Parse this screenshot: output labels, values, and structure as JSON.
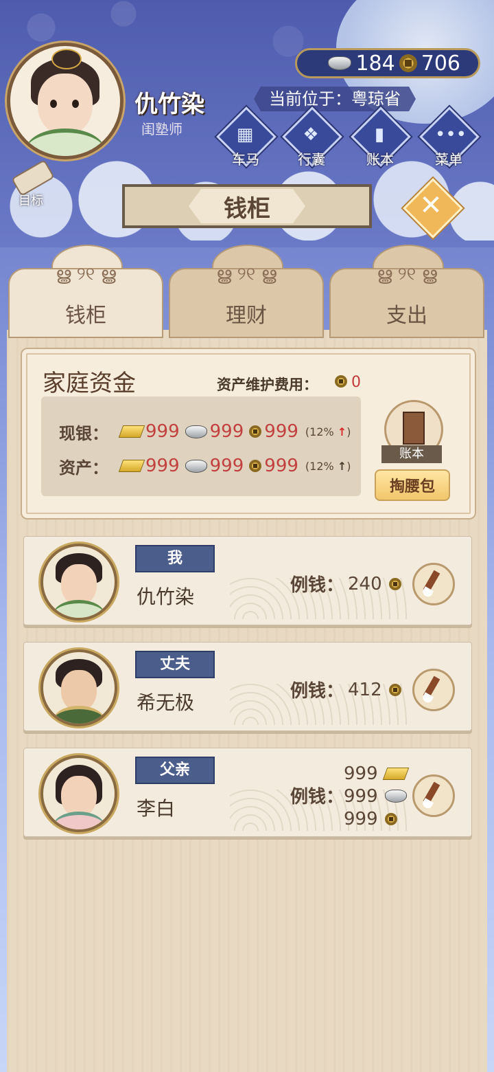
{
  "player": {
    "name": "仇竹染",
    "title": "闺塾师"
  },
  "currency": {
    "silver": "184",
    "coins": "706"
  },
  "location": "当前位于：粤琼省",
  "nav": [
    {
      "label": "车马",
      "icon": "carriage-icon"
    },
    {
      "label": "行囊",
      "icon": "bag-icon"
    },
    {
      "label": "账本",
      "icon": "ledger-icon"
    },
    {
      "label": "菜单",
      "icon": "menu-dots-icon"
    }
  ],
  "goal_label": "目标",
  "page_title": "钱柜",
  "tabs": [
    {
      "label": "钱柜",
      "active": true
    },
    {
      "label": "理财",
      "active": false
    },
    {
      "label": "支出",
      "active": false
    }
  ],
  "family_funds": {
    "title": "家庭资金",
    "fee_label": "资产维护费用：",
    "fee_value": "0",
    "rows": [
      {
        "label": "现银：",
        "gold": "999",
        "silver": "999",
        "coins": "999",
        "pct_open": "(12%",
        "arrow": "↑",
        "pct_close": ")",
        "arrow_color": "#d92a2a"
      },
      {
        "label": "资产：",
        "gold": "999",
        "silver": "999",
        "coins": "999",
        "pct_open": "(12%",
        "arrow": "↑",
        "pct_close": ")",
        "arrow_color": "#4a3a2d"
      }
    ],
    "ledger_label": "账本",
    "purse_label": "掏腰包"
  },
  "members": [
    {
      "role": "我",
      "name": "仇竹染",
      "allowance_label": "例钱：",
      "allowance": "240"
    },
    {
      "role": "丈夫",
      "name": "希无极",
      "allowance_label": "例钱：",
      "allowance": "412"
    },
    {
      "role": "父亲",
      "name": "李白",
      "allowance_label": "例钱：",
      "allowance_gold": "999",
      "allowance_silver": "999",
      "allowance_coins": "999"
    }
  ]
}
